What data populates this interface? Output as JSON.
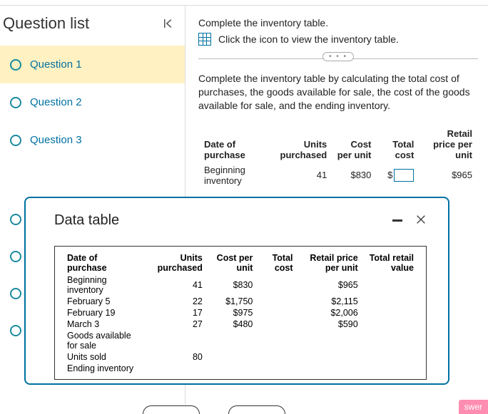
{
  "sidebar": {
    "title": "Question list",
    "items": [
      {
        "label": "Question 1"
      },
      {
        "label": "Question 2"
      },
      {
        "label": "Question 3"
      }
    ]
  },
  "content": {
    "instr_top": "Complete the inventory table.",
    "icon_hint": "Click the icon to view the inventory table.",
    "paragraph": "Complete the inventory table by calculating the total cost of purchases, the goods available for sale, the cost of the goods available for sale, and the ending inventory.",
    "headers": {
      "date": "Date of purchase",
      "units": "Units purchased",
      "cost_unit": "Cost per unit",
      "total_cost": "Total cost",
      "retail_unit": "Retail price per unit"
    },
    "row1": {
      "date": "Beginning inventory",
      "units": "41",
      "cost_unit": "$830",
      "total_cost_prefix": "$",
      "retail_unit": "$965"
    }
  },
  "modal": {
    "title": "Data table",
    "headers": {
      "date": "Date of purchase",
      "units": "Units purchased",
      "cost_unit": "Cost per unit",
      "total_cost": "Total cost",
      "retail_unit": "Retail price per unit",
      "total_retail": "Total retail value"
    },
    "rows": [
      {
        "date": "Beginning inventory",
        "units": "41",
        "cost_unit": "$830",
        "total_cost": "",
        "retail_unit": "$965",
        "total_retail": ""
      },
      {
        "date": "February 5",
        "units": "22",
        "cost_unit": "$1,750",
        "total_cost": "",
        "retail_unit": "$2,115",
        "total_retail": ""
      },
      {
        "date": "February 19",
        "units": "17",
        "cost_unit": "$975",
        "total_cost": "",
        "retail_unit": "$2,006",
        "total_retail": ""
      },
      {
        "date": "March 3",
        "units": "27",
        "cost_unit": "$480",
        "total_cost": "",
        "retail_unit": "$590",
        "total_retail": ""
      },
      {
        "date": "Goods available for sale",
        "units": "",
        "cost_unit": "",
        "total_cost": "",
        "retail_unit": "",
        "total_retail": ""
      },
      {
        "date": "Units sold",
        "units": "80",
        "cost_unit": "",
        "total_cost": "",
        "retail_unit": "",
        "total_retail": ""
      },
      {
        "date": "Ending inventory",
        "units": "",
        "cost_unit": "",
        "total_cost": "",
        "retail_unit": "",
        "total_retail": ""
      }
    ]
  },
  "footer_stub": "swer",
  "ellipsis": "• • •"
}
